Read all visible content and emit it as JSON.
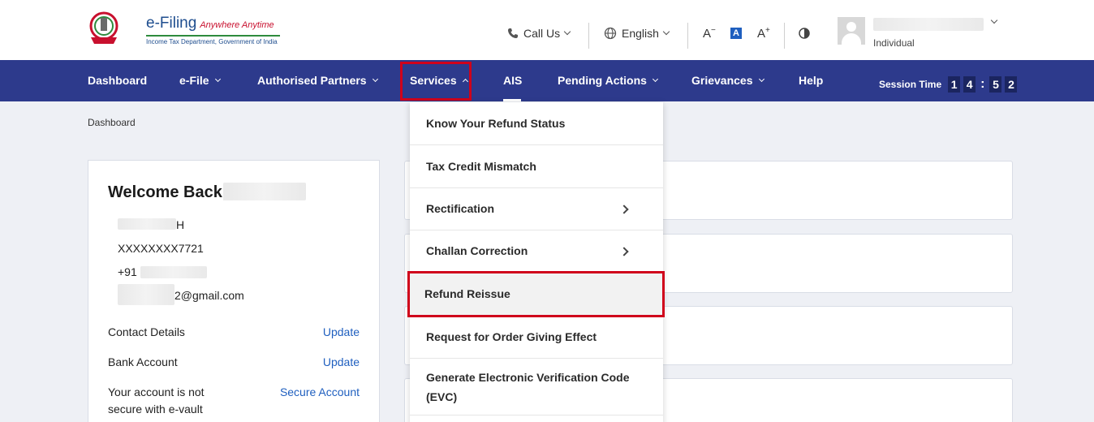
{
  "header": {
    "logo": {
      "brand": "e-Filing",
      "tagline": "Anywhere Anytime",
      "subtitle": "Income Tax Department, Government of India"
    },
    "call_us": "Call Us",
    "language": "English",
    "font_decrease": "A",
    "font_normal": "A",
    "font_increase": "A",
    "user_role": "Individual"
  },
  "nav": {
    "items": [
      "Dashboard",
      "e-File",
      "Authorised Partners",
      "Services",
      "AIS",
      "Pending Actions",
      "Grievances",
      "Help"
    ],
    "session_label": "Session Time",
    "session_digits": [
      "1",
      "4",
      "5",
      "2"
    ]
  },
  "breadcrumb": "Dashboard",
  "welcome": {
    "title": "Welcome Back,",
    "name_suffix": "H",
    "pan": "XXXXXXXX7721",
    "phone_prefix": "+91",
    "email_suffix": "2@gmail.com",
    "rows": [
      {
        "label": "Contact Details",
        "link": "Update"
      },
      {
        "label": "Bank Account",
        "link": "Update"
      },
      {
        "label": "Your account is not",
        "label2": "secure with e-vault",
        "link": "Secure Account"
      }
    ]
  },
  "services_menu": [
    {
      "label": "Know Your Refund Status",
      "submenu": false
    },
    {
      "label": "Tax Credit Mismatch",
      "submenu": false
    },
    {
      "label": "Rectification",
      "submenu": true
    },
    {
      "label": "Challan Correction",
      "submenu": true
    },
    {
      "label": "Refund Reissue",
      "submenu": false
    },
    {
      "label": "Request for Order Giving Effect",
      "submenu": false
    },
    {
      "label": "Generate Electronic Verification Code",
      "label2": "(EVC)",
      "submenu": false
    }
  ],
  "colors": {
    "nav_bg": "#2d3a8c",
    "highlight": "#d0021b",
    "link": "#1f5fbf"
  }
}
